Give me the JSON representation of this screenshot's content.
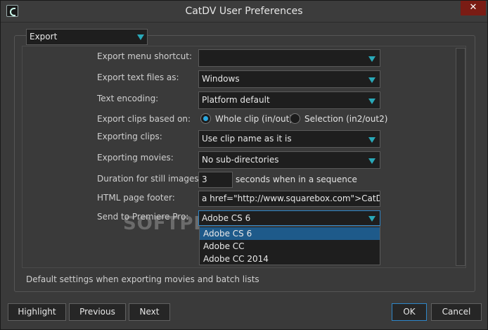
{
  "window": {
    "title": "CatDV User Preferences",
    "close_glyph": "✕"
  },
  "category": {
    "selected": "Export"
  },
  "form": {
    "export_menu_shortcut": {
      "label": "Export menu shortcut:",
      "value": ""
    },
    "export_text_files": {
      "label": "Export text files as:",
      "value": "Windows"
    },
    "text_encoding": {
      "label": "Text encoding:",
      "value": "Platform default"
    },
    "export_clips_based_on": {
      "label": "Export clips based on:",
      "options": [
        "Whole clip (in/out)",
        "Selection (in2/out2)"
      ],
      "selected": "Whole clip (in/out)"
    },
    "exporting_clips": {
      "label": "Exporting clips:",
      "value": "Use clip name as it is"
    },
    "exporting_movies": {
      "label": "Exporting movies:",
      "value": "No sub-directories"
    },
    "duration_still_images": {
      "label": "Duration for still images:",
      "value": "3",
      "suffix": "seconds when in a sequence"
    },
    "html_page_footer": {
      "label": "HTML page footer:",
      "value": "a href=\"http://www.squarebox.com\">CatDV</a>"
    },
    "send_to_premiere": {
      "label": "Send to Premiere Pro:",
      "value": "Adobe CS 6",
      "options": [
        "Adobe CS 6",
        "Adobe CC",
        "Adobe CC 2014"
      ],
      "highlighted": "Adobe CS 6"
    }
  },
  "status_text": "Default settings when exporting movies and batch lists",
  "watermark": "SOFTPEDIA",
  "buttons": {
    "highlight": "Highlight",
    "previous": "Previous",
    "next": "Next",
    "ok": "OK",
    "cancel": "Cancel"
  },
  "colors": {
    "accent": "#29a8b8",
    "selection": "#1e5a8a",
    "radio": "#2aa7e0"
  }
}
